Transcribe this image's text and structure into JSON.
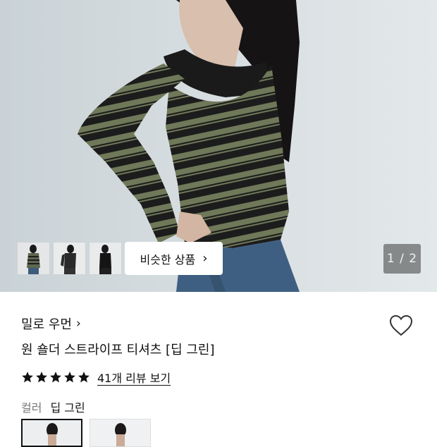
{
  "gallery": {
    "similar_button_label": "비슷한 상품",
    "similar_chevron": "›",
    "pager": "1 / 2",
    "thumbnails": [
      "thumbnail-1",
      "thumbnail-2",
      "thumbnail-3"
    ]
  },
  "product": {
    "brand": "밀로 우먼",
    "brand_chevron": "›",
    "title": "원 숄더 스트라이프 티셔츠 [딥 그린]",
    "rating_stars": 5,
    "review_link": "41개 리뷰 보기",
    "color_label": "컬러",
    "color_value": "딥 그린",
    "icons": {
      "wishlist": "heart-outline-icon",
      "star": "star-filled-icon"
    }
  },
  "colors": {
    "stripe_dark": "#1c1c1c",
    "stripe_olive": "#6f7858",
    "accent": "#111111"
  }
}
